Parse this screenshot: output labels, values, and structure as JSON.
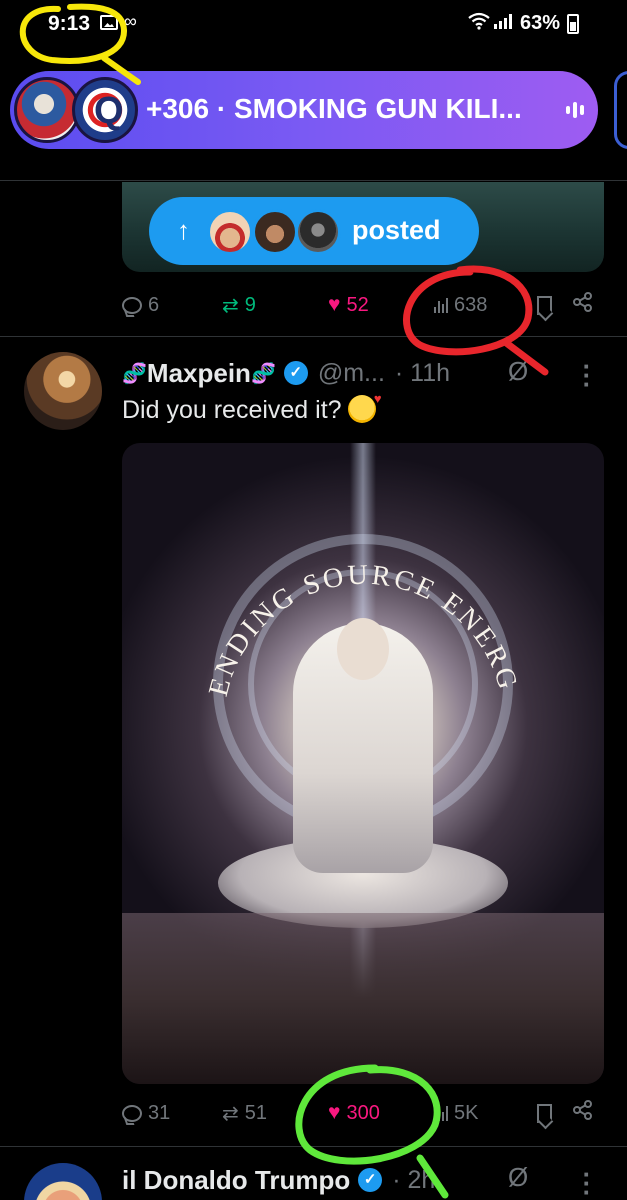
{
  "status_bar": {
    "time": "9:13",
    "battery": "63%",
    "icons": [
      "image-icon",
      "voicemail-icon",
      "wifi-icon",
      "signal-icon",
      "battery-icon"
    ]
  },
  "space_banner": {
    "title": "+306 · SMOKING GUN KILI...",
    "gradient_colors": [
      "#5a4cf0",
      "#9e5cf2"
    ]
  },
  "tweet_1": {
    "posted_pill_label": "posted",
    "replies": "6",
    "reposts": "9",
    "likes": "52",
    "views": "638"
  },
  "tweet_2": {
    "display_name": "Maxpein",
    "name_decoration": "🧬",
    "handle": "@m...",
    "time": "· 11h",
    "text": "Did you received it?",
    "media_text": "SENDING SOURCE ENERGY",
    "replies": "31",
    "reposts": "51",
    "likes": "300",
    "views": "5K"
  },
  "tweet_3": {
    "display_name": "il Donaldo Trumpo",
    "time": "· 2h"
  },
  "colors": {
    "accent": "#1d9bf0",
    "like": "#f91880",
    "repost": "#00ba7c",
    "muted": "#71767b"
  }
}
